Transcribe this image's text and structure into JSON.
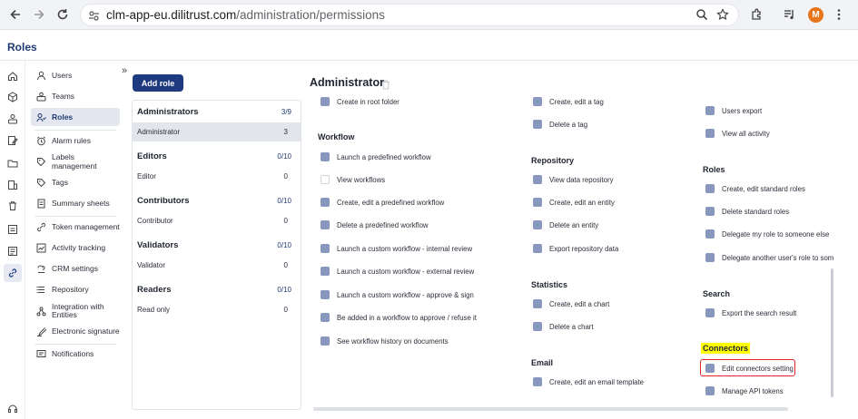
{
  "browser": {
    "url_host": "clm-app-eu.dilitrust.com",
    "url_path": "/administration/permissions",
    "avatar_letter": "M",
    "avatar_color": "#e8741c"
  },
  "page": {
    "title": "Roles"
  },
  "sidebar": {
    "items": [
      {
        "label": "Users",
        "icon": "user-icon"
      },
      {
        "label": "Teams",
        "icon": "team-icon"
      },
      {
        "label": "Roles",
        "icon": "roles-icon",
        "active": true
      },
      {
        "label": "Alarm rules",
        "icon": "alarm-icon"
      },
      {
        "label": "Labels management",
        "icon": "label-icon"
      },
      {
        "label": "Tags",
        "icon": "tag-icon"
      },
      {
        "label": "Summary sheets",
        "icon": "summary-icon"
      },
      {
        "label": "Token management",
        "icon": "token-icon"
      },
      {
        "label": "Activity tracking",
        "icon": "activity-icon"
      },
      {
        "label": "CRM settings",
        "icon": "crm-icon"
      },
      {
        "label": "Repository",
        "icon": "repository-icon"
      },
      {
        "label": "Integration with Entities",
        "icon": "integration-icon"
      },
      {
        "label": "Electronic signature",
        "icon": "signature-icon"
      },
      {
        "label": "Notifications",
        "icon": "notification-icon"
      }
    ]
  },
  "roles_panel": {
    "add_label": "Add role",
    "groups": [
      {
        "name": "Administrators",
        "count": "3/9",
        "roles": [
          {
            "name": "Administrator",
            "count": "3",
            "selected": true
          }
        ]
      },
      {
        "name": "Editors",
        "count": "0/10",
        "roles": [
          {
            "name": "Editor",
            "count": "0"
          }
        ]
      },
      {
        "name": "Contributors",
        "count": "0/10",
        "roles": [
          {
            "name": "Contributor",
            "count": "0"
          }
        ]
      },
      {
        "name": "Validators",
        "count": "0/10",
        "roles": [
          {
            "name": "Validator",
            "count": "0"
          }
        ]
      },
      {
        "name": "Readers",
        "count": "0/10",
        "roles": [
          {
            "name": "Read only",
            "count": "0"
          }
        ]
      }
    ]
  },
  "content": {
    "title": "Administrator",
    "col1": {
      "top_item": "Create in root folder",
      "workflow_title": "Workflow",
      "workflow": [
        {
          "label": "Launch a predefined workflow",
          "checked": true
        },
        {
          "label": "View workflows",
          "checked": false
        },
        {
          "label": "Create, edit a predefined workflow",
          "checked": true
        },
        {
          "label": "Delete a predefined workflow",
          "checked": true
        },
        {
          "label": "Launch a custom workflow - internal review",
          "checked": true
        },
        {
          "label": "Launch a custom workflow - external review",
          "checked": true
        },
        {
          "label": "Launch a custom workflow - approve & sign",
          "checked": true
        },
        {
          "label": "Be added in a workflow to approve / refuse it",
          "checked": true
        },
        {
          "label": "See workflow history on documents",
          "checked": true
        }
      ]
    },
    "col2": {
      "top_items": [
        "Create, edit a tag",
        "Delete a tag"
      ],
      "repository_title": "Repository",
      "repository": [
        "View data repository",
        "Create, edit an entity",
        "Delete an entity",
        "Export repository data"
      ],
      "statistics_title": "Statistics",
      "statistics": [
        "Create, edit a chart",
        "Delete a chart"
      ],
      "email_title": "Email",
      "email": [
        "Create, edit an email template"
      ]
    },
    "col3": {
      "top_items": [
        "Users export",
        "View all activity"
      ],
      "roles_title": "Roles",
      "roles": [
        "Create, edit standard roles",
        "Delete standard roles",
        "Delegate my role to someone else",
        "Delegate another user's role to som"
      ],
      "search_title": "Search",
      "search": [
        "Export the search result"
      ],
      "connectors_title": "Connectors",
      "connectors": [
        "Edit connectors setting",
        "Manage API tokens"
      ]
    }
  },
  "colors": {
    "brand": "#1f3b80",
    "checkbox": "#8797bd",
    "highlight": "#ffff00",
    "focus_box": "#e0262a"
  }
}
